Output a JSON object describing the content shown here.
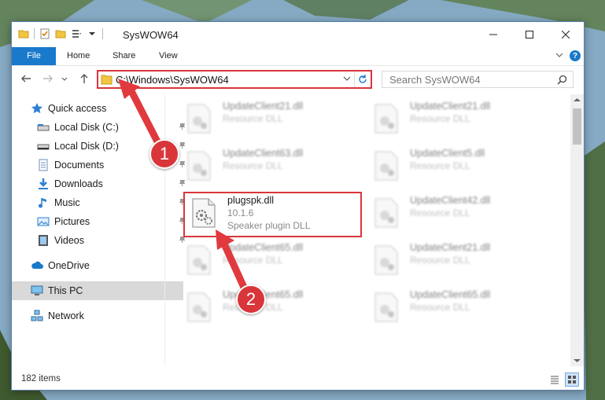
{
  "window": {
    "title": "SysWOW64",
    "controls": [
      "minimize",
      "maximize",
      "close"
    ]
  },
  "ribbon": {
    "tabs": [
      {
        "label": "File",
        "active": true
      },
      {
        "label": "Home"
      },
      {
        "label": "Share"
      },
      {
        "label": "View"
      }
    ]
  },
  "navigation": {
    "address": "C:\\Windows\\SysWOW64",
    "search_placeholder": "Search SysWOW64"
  },
  "sidebar": {
    "items": [
      {
        "label": "Quick access",
        "icon": "star-icon"
      },
      {
        "label": "Local Disk (C:)",
        "icon": "drive-icon",
        "pinned": true
      },
      {
        "label": "Local Disk (D:)",
        "icon": "drive-icon",
        "pinned": true
      },
      {
        "label": "Documents",
        "icon": "documents-icon",
        "pinned": true
      },
      {
        "label": "Downloads",
        "icon": "downloads-icon",
        "pinned": true
      },
      {
        "label": "Music",
        "icon": "music-icon",
        "pinned": true
      },
      {
        "label": "Pictures",
        "icon": "pictures-icon",
        "pinned": true
      },
      {
        "label": "Videos",
        "icon": "videos-icon",
        "pinned": true
      },
      {
        "label": "OneDrive",
        "icon": "cloud-icon"
      },
      {
        "label": "This PC",
        "icon": "computer-icon",
        "selected": true
      },
      {
        "label": "Network",
        "icon": "network-icon"
      }
    ]
  },
  "files": [
    {
      "name": "UpdateClient21.dll",
      "desc": "Resource DLL",
      "blurred": true
    },
    {
      "name": "UpdateClient21.dll",
      "desc": "Resource DLL",
      "blurred": true
    },
    {
      "name": "UpdateClient63.dll",
      "desc": "Resource DLL",
      "blurred": true
    },
    {
      "name": "UpdateClient5.dll",
      "desc": "Resource DLL",
      "blurred": true
    },
    {
      "name": "plugspk.dll",
      "version": "10.1.6",
      "desc": "Speaker plugin DLL",
      "blurred": false,
      "highlighted": true
    },
    {
      "name": "UpdateClient42.dll",
      "desc": "Resource DLL",
      "blurred": true
    },
    {
      "name": "UpdateClient65.dll",
      "desc": "Resource DLL",
      "blurred": true
    },
    {
      "name": "UpdateClient21.dll",
      "desc": "Resource DLL",
      "blurred": true
    },
    {
      "name": "UpdateClient65.dll",
      "desc": "Resource DLL",
      "blurred": true
    },
    {
      "name": "UpdateClient65.dll",
      "desc": "Resource DLL",
      "blurred": true
    }
  ],
  "status": {
    "item_count": "182 items"
  },
  "callouts": [
    "1",
    "2"
  ],
  "colors": {
    "accent": "#1979ca",
    "highlight": "#d8363b"
  }
}
